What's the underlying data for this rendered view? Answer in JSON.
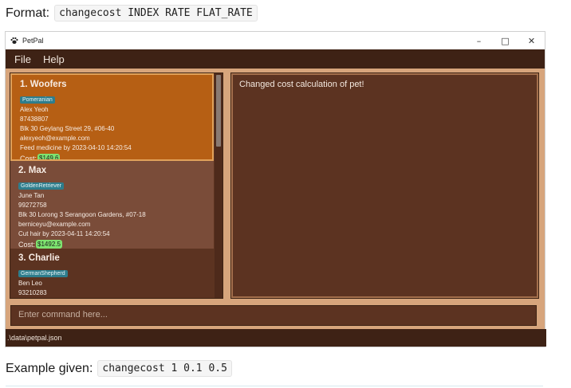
{
  "doc": {
    "format_label": "Format:",
    "format_code": "changecost INDEX RATE FLAT_RATE",
    "example_label": "Example given:",
    "example_code": "changecost 1 0.1 0.5"
  },
  "window": {
    "title": "PetPal",
    "icon": "paw-icon",
    "controls": {
      "minimize": "–",
      "maximize": "□",
      "close": "✕"
    }
  },
  "menu": {
    "file": "File",
    "help": "Help"
  },
  "pets": [
    {
      "title": "1.  Woofers",
      "tag": "Pomeranian",
      "owner": "Alex Yeoh",
      "phone": "87438807",
      "address": "Blk 30 Geylang Street 29, #06-40",
      "email": "alexyeoh@example.com",
      "reminder": "Feed medicine by 2023-04-10 14:20:54",
      "cost_label": "Cost:",
      "cost": "$149.6"
    },
    {
      "title": "2.  Max",
      "tag": "GoldenRetriever",
      "owner": "June Tan",
      "phone": "99272758",
      "address": "Blk 30 Lorong 3 Serangoon Gardens, #07-18",
      "email": "berniceyu@example.com",
      "reminder": "Cut hair by 2023-04-11 14:20:54",
      "cost_label": "Cost:",
      "cost": "$1492.5"
    },
    {
      "title": "3.  Charlie",
      "tag": "GermanShepherd",
      "owner": "Ben Leo",
      "phone": "93210283"
    }
  ],
  "result": {
    "message": "Changed cost calculation of pet!"
  },
  "command": {
    "placeholder": "Enter command here..."
  },
  "status": {
    "path": ".\\data\\petpal.json"
  },
  "colors": {
    "selected_card": "#b65f14",
    "card_alt": "#7a4c39",
    "card_base": "#5c3321",
    "tag": "#2e7d8c",
    "cost_badge": "#7ee36f",
    "frame": "#d7a57c",
    "dark_bar": "#3e2215"
  }
}
